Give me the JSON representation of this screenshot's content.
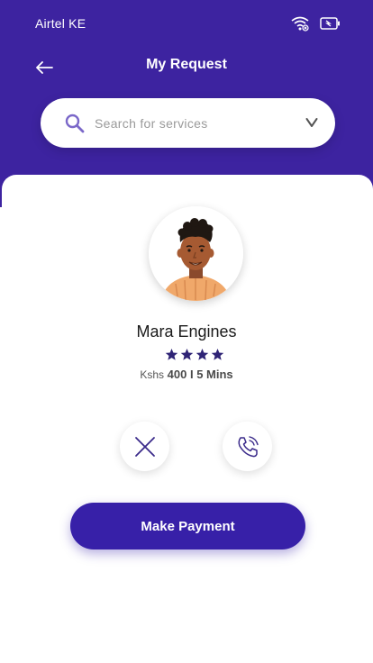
{
  "status_bar": {
    "carrier": "Airtel KE",
    "icons": [
      "wifi-icon",
      "battery-icon"
    ]
  },
  "header": {
    "title": "My Request",
    "back_icon": "arrow-left-icon"
  },
  "search": {
    "placeholder": "Search for services",
    "value": "",
    "icon": "search-icon",
    "dropdown_icon": "chevron-down-icon"
  },
  "provider": {
    "name": "Mara Engines",
    "rating": 4,
    "rating_max": 4,
    "currency": "Kshs",
    "price": "400",
    "separator": "I",
    "duration": "5 Mins"
  },
  "actions": {
    "cancel_icon": "close-icon",
    "call_icon": "phone-icon",
    "pay_label": "Make Payment"
  },
  "colors": {
    "primary": "#3d23a0",
    "button": "#3720a8",
    "star": "#2f2476",
    "search_icon": "#7b68c9"
  }
}
